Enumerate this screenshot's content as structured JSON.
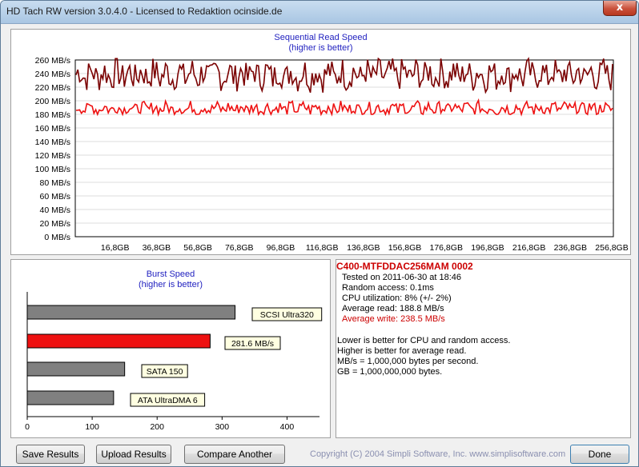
{
  "window": {
    "title": "HD Tach RW version 3.0.4.0 - Licensed to Redaktion ocinside.de",
    "close_glyph": "x"
  },
  "colors": {
    "read_line": "#7a0000",
    "write_line": "#ee1111",
    "burst_highlight": "#ee1111",
    "burst_bar": "#808080",
    "title_blue": "#1f1fbf"
  },
  "sequential": {
    "title_line1": "Sequential Read Speed",
    "title_line2": "(higher is better)"
  },
  "burst": {
    "title_line1": "Burst Speed",
    "title_line2": "(higher is better)"
  },
  "chart_data": [
    {
      "type": "line",
      "title": "Sequential Read Speed",
      "subtitle": "(higher is better)",
      "y_unit": "MB/s",
      "ylim": [
        0,
        260
      ],
      "y_ticks": [
        "0 MB/s",
        "20 MB/s",
        "40 MB/s",
        "60 MB/s",
        "80 MB/s",
        "100 MB/s",
        "120 MB/s",
        "140 MB/s",
        "160 MB/s",
        "180 MB/s",
        "200 MB/s",
        "220 MB/s",
        "240 MB/s",
        "260 MB/s"
      ],
      "x_ticks": [
        "16,8GB",
        "36,8GB",
        "56,8GB",
        "76,8GB",
        "96,8GB",
        "116,8GB",
        "136,8GB",
        "156,8GB",
        "176,8GB",
        "196,8GB",
        "216,8GB",
        "236,8GB",
        "256,8GB"
      ],
      "xlim": [
        0,
        256.8
      ],
      "grid": true,
      "series": [
        {
          "key": "read",
          "avg": 238.5,
          "min": 212,
          "max": 262
        },
        {
          "key": "write",
          "avg": 188.8,
          "min": 180,
          "max": 202
        }
      ]
    },
    {
      "type": "bar",
      "title": "Burst Speed",
      "subtitle": "(higher is better)",
      "orientation": "horizontal",
      "xlim": [
        0,
        450
      ],
      "x_ticks": [
        "0",
        "100",
        "200",
        "300",
        "400"
      ],
      "categories": [
        "SCSI Ultra320",
        "281.6 MB/s",
        "SATA 150",
        "ATA UltraDMA 6"
      ],
      "values": [
        320,
        281.6,
        150,
        133
      ],
      "highlight_index": 1
    }
  ],
  "info": {
    "drive_name": "C400-MTFDDAC256MAM 0002",
    "tested": "Tested on 2011-06-30 at 18:46",
    "random_access": "Random access: 0.1ms",
    "cpu": "CPU utilization: 8% (+/- 2%)",
    "avg_read": "Average read: 188.8 MB/s",
    "avg_write": "Average write: 238.5 MB/s",
    "notes": [
      "Lower is better for CPU and random access.",
      "Higher is better for average read.",
      "MB/s = 1,000,000 bytes per second.",
      "GB = 1,000,000,000 bytes."
    ]
  },
  "buttons": {
    "save": "Save Results",
    "upload": "Upload Results",
    "compare": "Compare Another Drive",
    "done": "Done"
  },
  "copyright": "Copyright (C) 2004 Simpli Software, Inc. www.simplisoftware.com"
}
